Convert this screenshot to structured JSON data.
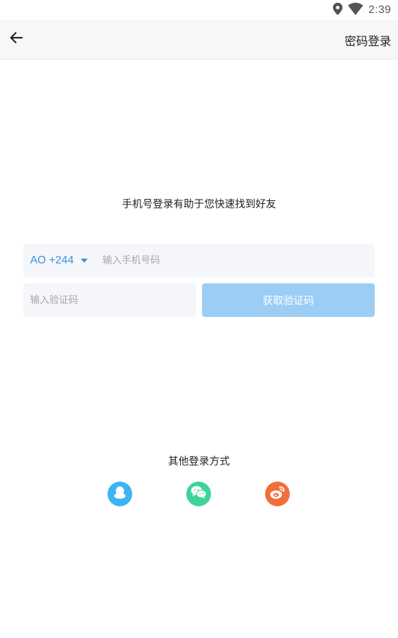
{
  "status_bar": {
    "time": "2:39",
    "icons": [
      "location-icon",
      "wifi-icon"
    ]
  },
  "header": {
    "back_icon": "arrow-left-icon",
    "right_action": "密码登录"
  },
  "main": {
    "hint": "手机号登录有助于您快速找到好友",
    "country_code": "AO +244",
    "phone_placeholder": "输入手机号码",
    "phone_value": "",
    "code_placeholder": "输入验证码",
    "code_value": "",
    "get_code_label": "获取验证码"
  },
  "other_login": {
    "title": "其他登录方式",
    "providers": [
      {
        "name": "qq",
        "icon": "qq-icon",
        "color": "#3cb3f5"
      },
      {
        "name": "wechat",
        "icon": "wechat-icon",
        "color": "#3fd39b"
      },
      {
        "name": "weibo",
        "icon": "weibo-icon",
        "color": "#f26e3a"
      }
    ]
  },
  "colors": {
    "accent": "#3a8ee6",
    "button_disabled": "#9ccdf4",
    "input_bg": "#f5f6f9",
    "header_bg": "#f7f7f7"
  }
}
